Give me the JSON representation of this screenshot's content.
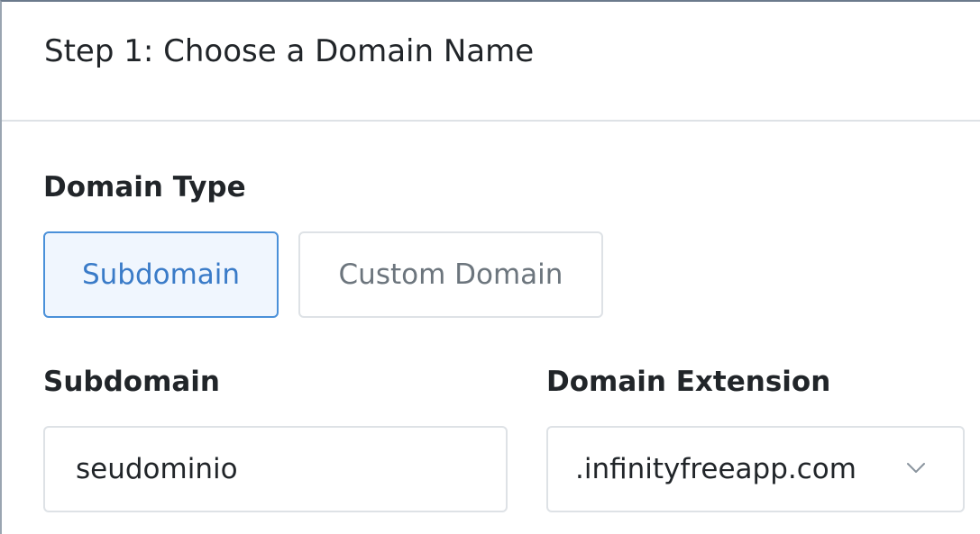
{
  "card": {
    "title": "Step 1: Choose a Domain Name"
  },
  "domain_type": {
    "label": "Domain Type",
    "options": [
      {
        "label": "Subdomain",
        "selected": true
      },
      {
        "label": "Custom Domain",
        "selected": false
      }
    ]
  },
  "subdomain": {
    "label": "Subdomain",
    "value": "seudominio"
  },
  "extension": {
    "label": "Domain Extension",
    "selected_value": ".infinityfreeapp.com",
    "icon": "chevron-down-icon"
  },
  "colors": {
    "accent": "#4a90d9",
    "accent_bg": "#f0f6fe",
    "border": "#dee2e6",
    "text": "#212529",
    "muted": "#6c757d"
  }
}
